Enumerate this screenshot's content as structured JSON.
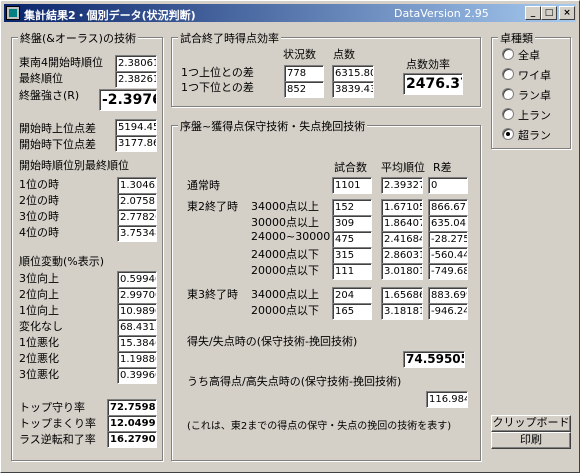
{
  "window": {
    "title": "集計結果2・個別データ(状況判断)",
    "version": "DataVersion 2.95",
    "minimize": "_",
    "maximize": "□",
    "close": "×"
  },
  "endgame": {
    "title": "終盤(&オーラス)の技術",
    "east4_label": "東南4開始時順位",
    "east4_value": "2.38061",
    "final_label": "最終順位",
    "final_value": "2.38261",
    "strength_label": "終盤強さ(R)",
    "strength_value": "-2.3976",
    "diff_top_label": "開始時上位点差",
    "diff_top_value": "5194.45",
    "diff_bottom_label": "開始時下位点差",
    "diff_bottom_value": "3177.86",
    "final_by_start_title": "開始時順位別最終順位",
    "final_by_start": [
      {
        "label": "1位の時",
        "value": "1.30465"
      },
      {
        "label": "2位の時",
        "value": "2.07581"
      },
      {
        "label": "3位の時",
        "value": "2.77826"
      },
      {
        "label": "4位の時",
        "value": "3.75348"
      }
    ],
    "rank_change_title": "順位変動(%表示)",
    "rank_change": [
      {
        "label": "3位向上",
        "value": "0.59940"
      },
      {
        "label": "2位向上",
        "value": "2.99700"
      },
      {
        "label": "1位向上",
        "value": "10.9890"
      },
      {
        "label": "変化なし",
        "value": "68.4315"
      },
      {
        "label": "1位悪化",
        "value": "15.3846"
      },
      {
        "label": "2位悪化",
        "value": "1.19880"
      },
      {
        "label": "3位悪化",
        "value": "0.39960"
      }
    ],
    "top_keep_label": "トップ守り率",
    "top_keep_value": "72.7598",
    "top_take_label": "トップまくり率",
    "top_take_value": "12.0499",
    "last_escape_label": "ラス逆転和了率",
    "last_escape_value": "16.2790"
  },
  "efficiency": {
    "title": "試合終了時得点効率",
    "col_count": "状況数",
    "col_points": "点数",
    "row1_label": "1つ上位との差",
    "row1_count": "778",
    "row1_points": "6315.80",
    "row2_label": "1つ下位との差",
    "row2_count": "852",
    "row2_points": "3839.43",
    "eff_label": "点数効率",
    "eff_value": "2476.37"
  },
  "middle": {
    "title": "序盤~獲得点保守技術・失点挽回技術",
    "col_games": "試合数",
    "col_avg": "平均順位",
    "col_r": "R差",
    "normal_label": "通常時",
    "normal": [
      "1101",
      "2.39327",
      "0"
    ],
    "e2_label": "東2終了時",
    "e2_rows": [
      {
        "label": "34000点以上",
        "v": [
          "152",
          "1.67105",
          "866.671"
        ]
      },
      {
        "label": "30000点以上",
        "v": [
          "309",
          "1.86407",
          "635.041"
        ]
      },
      {
        "label": "24000~30000",
        "v": [
          "475",
          "2.41684",
          "-28.275"
        ]
      },
      {
        "label": "24000点以下",
        "v": [
          "315",
          "2.86031",
          "-560.44"
        ]
      },
      {
        "label": "20000点以下",
        "v": [
          "111",
          "3.01801",
          "-749.68"
        ]
      }
    ],
    "e3_label": "東3終了時",
    "e3_rows": [
      {
        "label": "34000点以上",
        "v": [
          "204",
          "1.65686",
          "883.699"
        ]
      },
      {
        "label": "20000点以下",
        "v": [
          "165",
          "3.18181",
          "-946.24"
        ]
      }
    ],
    "gain_label": "得失/失点時の(保守技術-挽回技術)",
    "gain_value": "74.59505",
    "high_label": "うち高得点/高失点時の(保守技術-挽回技術)",
    "high_value": "116.984",
    "note": "(これは、東2までの得点の保守・失点の挽回の技術を表す)"
  },
  "table_type": {
    "title": "卓種類",
    "options": [
      {
        "label": "全卓",
        "selected": false
      },
      {
        "label": "ワイ卓",
        "selected": false
      },
      {
        "label": "ラン卓",
        "selected": false
      },
      {
        "label": "上ラン",
        "selected": false
      },
      {
        "label": "超ラン",
        "selected": true
      }
    ]
  },
  "buttons": {
    "clipboard": "クリップボード",
    "print": "印刷"
  }
}
